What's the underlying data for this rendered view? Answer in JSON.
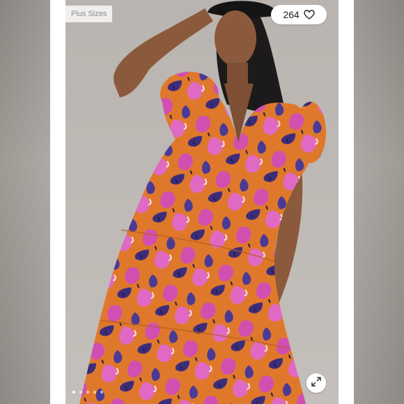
{
  "listing": {
    "badge_label": "Plus Sizes",
    "like_count": "264",
    "like_icon": "heart-outline-icon",
    "expand_icon": "expand-arrows-icon"
  },
  "gallery": {
    "dot_count": 5,
    "active_index": 0
  },
  "colors": {
    "background": "#ffffff",
    "badge_bg": "#f0efed",
    "badge_text": "#8a8a8a",
    "dress_orange": "#e17a2b",
    "dress_pink": "#d24fb0",
    "dress_purple": "#3b2d7a"
  }
}
